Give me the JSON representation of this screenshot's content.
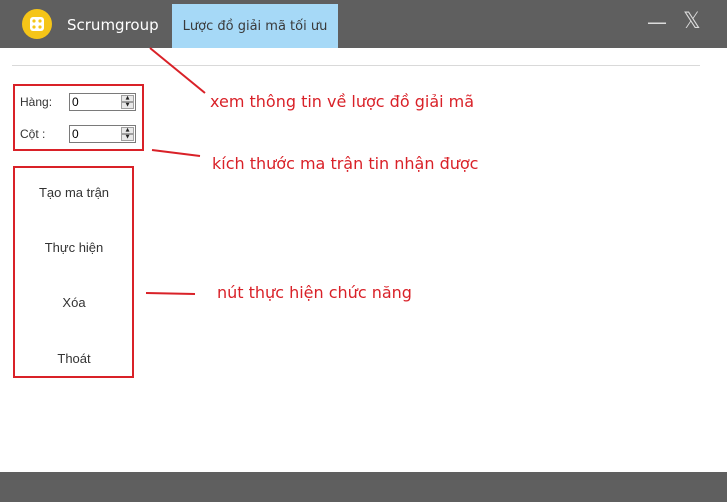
{
  "titlebar": {
    "brand": "Scrumgroup",
    "active_tab": "Lược đồ giải mã tối ưu",
    "minimize_glyph": "—",
    "close_glyph": "𝕏"
  },
  "form": {
    "rows_label": "Hàng:",
    "rows_value": "0",
    "cols_label": "Cột   :",
    "cols_value": "0"
  },
  "buttons": {
    "create_matrix": "Tạo ma trận",
    "execute": "Thực hiện",
    "delete": "Xóa",
    "exit": "Thoát"
  },
  "annotations": {
    "tab_note": "xem thông tin về lược đồ giải mã",
    "size_note": "kích thước ma trận tin nhận được",
    "buttons_note": "nút thực hiện chức năng"
  },
  "colors": {
    "titlebar": "#5f5f5f",
    "active_tab": "#a6d9f7",
    "annotation": "#d92128",
    "logo": "#f5c518"
  },
  "icons": {
    "logo": "dice-logo-icon"
  }
}
